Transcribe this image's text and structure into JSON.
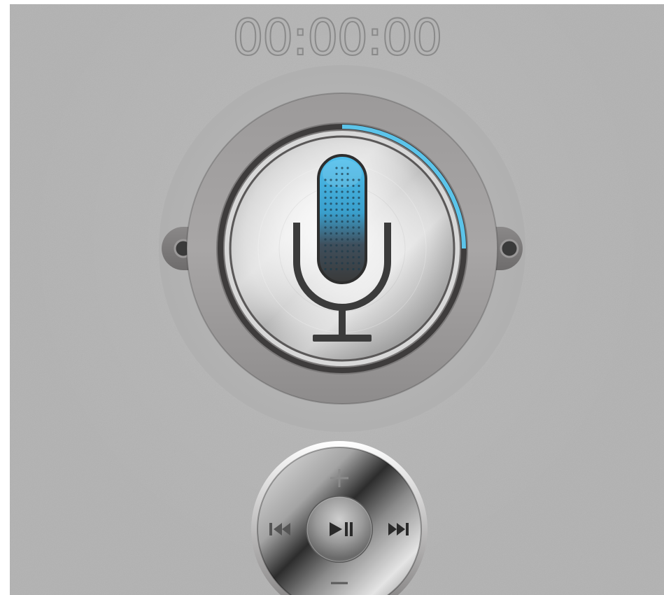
{
  "timer": {
    "elapsed": "00:00:00"
  },
  "recorder": {
    "icon": "microphone-icon",
    "progress_ring_fraction": 0.25,
    "accent_color": "#5cc4ea"
  },
  "player": {
    "volume_up_icon": "plus-icon",
    "volume_down_icon": "minus-icon",
    "previous_icon": "previous-track-icon",
    "next_icon": "next-track-icon",
    "play_pause_icon": "play-pause-icon"
  }
}
